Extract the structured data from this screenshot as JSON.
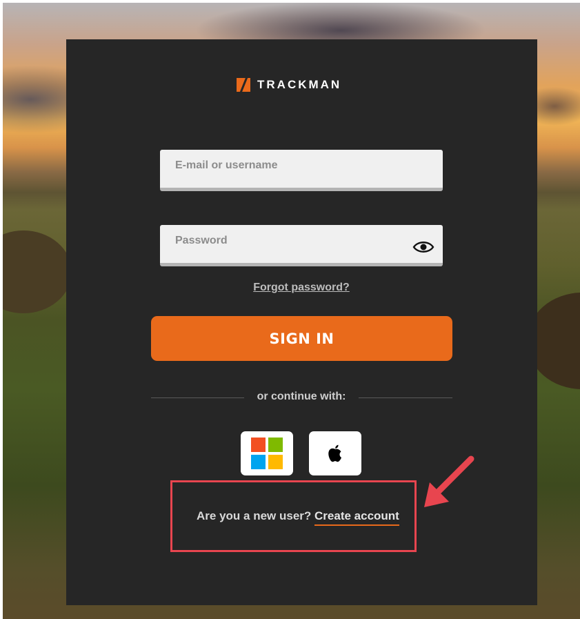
{
  "brand": {
    "name": "TRACKMAN",
    "accent": "#E96A1B"
  },
  "form": {
    "username_placeholder": "E-mail or username",
    "password_placeholder": "Password",
    "forgot_password": "Forgot password?",
    "sign_in": "SIGN IN"
  },
  "sso": {
    "divider_label": "or continue with:",
    "providers": [
      {
        "icon": "microsoft-icon"
      },
      {
        "icon": "apple-icon"
      }
    ]
  },
  "signup": {
    "prompt": "Are you a new user?",
    "link": "Create account"
  },
  "annotation": {
    "highlight_color": "#E8454F"
  }
}
